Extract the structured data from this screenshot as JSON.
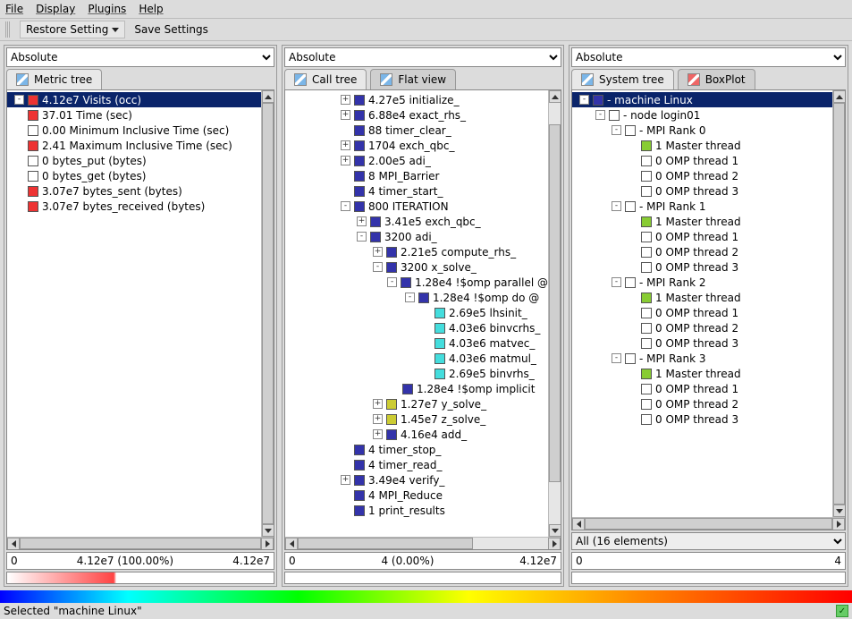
{
  "menubar": [
    "File",
    "Display",
    "Plugins",
    "Help"
  ],
  "toolbar": {
    "restore": "Restore Setting",
    "save": "Save Settings"
  },
  "columns": {
    "c1": {
      "select": "Absolute",
      "tabs": [
        {
          "label": "Metric tree",
          "active": true
        }
      ],
      "tree": [
        {
          "d": 0,
          "e": "-",
          "col": "#e33",
          "sel": true,
          "t": "4.12e7 Visits (occ)"
        },
        {
          "d": 0,
          "e": "",
          "col": "#e33",
          "t": "37.01 Time (sec)"
        },
        {
          "d": 0,
          "e": "",
          "col": "#fff",
          "t": "0.00 Minimum Inclusive Time (sec)"
        },
        {
          "d": 0,
          "e": "",
          "col": "#e33",
          "t": "2.41 Maximum Inclusive Time (sec)"
        },
        {
          "d": 0,
          "e": "",
          "col": "#fff",
          "t": "0 bytes_put (bytes)"
        },
        {
          "d": 0,
          "e": "",
          "col": "#fff",
          "t": "0 bytes_get (bytes)"
        },
        {
          "d": 0,
          "e": "",
          "col": "#e33",
          "t": "3.07e7 bytes_sent (bytes)"
        },
        {
          "d": 0,
          "e": "",
          "col": "#e33",
          "t": "3.07e7 bytes_received (bytes)"
        }
      ],
      "range": {
        "l": "0",
        "m": "4.12e7 (100.00%)",
        "r": "4.12e7"
      },
      "grad": "r"
    },
    "c2": {
      "select": "Absolute",
      "tabs": [
        {
          "label": "Call tree",
          "active": true
        },
        {
          "label": "Flat view",
          "active": false
        }
      ],
      "tree": [
        {
          "d": 3,
          "e": "+",
          "col": "#33a",
          "t": "4.27e5 initialize_"
        },
        {
          "d": 3,
          "e": "+",
          "col": "#33a",
          "t": "6.88e4 exact_rhs_"
        },
        {
          "d": 3,
          "e": "",
          "col": "#33a",
          "t": "88 timer_clear_"
        },
        {
          "d": 3,
          "e": "+",
          "col": "#33a",
          "t": "1704 exch_qbc_"
        },
        {
          "d": 3,
          "e": "+",
          "col": "#33a",
          "t": "2.00e5 adi_"
        },
        {
          "d": 3,
          "e": "",
          "col": "#33a",
          "t": "8 MPI_Barrier"
        },
        {
          "d": 3,
          "e": "",
          "col": "#33a",
          "t": "4 timer_start_"
        },
        {
          "d": 3,
          "e": "-",
          "col": "#33a",
          "t": "800 ITERATION"
        },
        {
          "d": 4,
          "e": "+",
          "col": "#33a",
          "t": "3.41e5 exch_qbc_"
        },
        {
          "d": 4,
          "e": "-",
          "col": "#33a",
          "t": "3200 adi_"
        },
        {
          "d": 5,
          "e": "+",
          "col": "#33a",
          "t": "2.21e5 compute_rhs_"
        },
        {
          "d": 5,
          "e": "-",
          "col": "#33a",
          "t": "3200 x_solve_"
        },
        {
          "d": 6,
          "e": "-",
          "col": "#33a",
          "t": "1.28e4 !$omp parallel @"
        },
        {
          "d": 7,
          "e": "-",
          "col": "#33a",
          "t": "1.28e4 !$omp do @"
        },
        {
          "d": 8,
          "e": "",
          "col": "#4dd",
          "t": "2.69e5 lhsinit_"
        },
        {
          "d": 8,
          "e": "",
          "col": "#4dd",
          "t": "4.03e6 binvcrhs_"
        },
        {
          "d": 8,
          "e": "",
          "col": "#4dd",
          "t": "4.03e6 matvec_"
        },
        {
          "d": 8,
          "e": "",
          "col": "#4dd",
          "t": "4.03e6 matmul_"
        },
        {
          "d": 8,
          "e": "",
          "col": "#4dd",
          "t": "2.69e5 binvrhs_"
        },
        {
          "d": 6,
          "e": "",
          "col": "#33a",
          "t": "1.28e4 !$omp implicit"
        },
        {
          "d": 5,
          "e": "+",
          "col": "#cc3",
          "t": "1.27e7 y_solve_"
        },
        {
          "d": 5,
          "e": "+",
          "col": "#cc3",
          "t": "1.45e7 z_solve_"
        },
        {
          "d": 5,
          "e": "+",
          "col": "#33a",
          "t": "4.16e4 add_"
        },
        {
          "d": 3,
          "e": "",
          "col": "#33a",
          "t": "4 timer_stop_"
        },
        {
          "d": 3,
          "e": "",
          "col": "#33a",
          "t": "4 timer_read_"
        },
        {
          "d": 3,
          "e": "+",
          "col": "#33a",
          "t": "3.49e4 verify_"
        },
        {
          "d": 3,
          "e": "",
          "col": "#33a",
          "t": "4 MPI_Reduce"
        },
        {
          "d": 3,
          "e": "",
          "col": "#33a",
          "t": "1 print_results"
        }
      ],
      "range": {
        "l": "0",
        "m": "4 (0.00%)",
        "r": "4.12e7"
      },
      "grad": "w"
    },
    "c3": {
      "select": "Absolute",
      "tabs": [
        {
          "label": "System tree",
          "active": true
        },
        {
          "label": "BoxPlot",
          "active": false,
          "red": true
        }
      ],
      "tree": [
        {
          "d": 0,
          "e": "-",
          "col": "#33a",
          "sel": true,
          "t": "- machine Linux"
        },
        {
          "d": 1,
          "e": "-",
          "col": "#fff",
          "t": "- node login01"
        },
        {
          "d": 2,
          "e": "-",
          "col": "#fff",
          "t": "- MPI Rank 0"
        },
        {
          "d": 3,
          "e": "",
          "col": "#8c3",
          "t": "1 Master thread"
        },
        {
          "d": 3,
          "e": "",
          "col": "#fff",
          "t": "0 OMP thread 1"
        },
        {
          "d": 3,
          "e": "",
          "col": "#fff",
          "t": "0 OMP thread 2"
        },
        {
          "d": 3,
          "e": "",
          "col": "#fff",
          "t": "0 OMP thread 3"
        },
        {
          "d": 2,
          "e": "-",
          "col": "#fff",
          "t": "- MPI Rank 1"
        },
        {
          "d": 3,
          "e": "",
          "col": "#8c3",
          "t": "1 Master thread"
        },
        {
          "d": 3,
          "e": "",
          "col": "#fff",
          "t": "0 OMP thread 1"
        },
        {
          "d": 3,
          "e": "",
          "col": "#fff",
          "t": "0 OMP thread 2"
        },
        {
          "d": 3,
          "e": "",
          "col": "#fff",
          "t": "0 OMP thread 3"
        },
        {
          "d": 2,
          "e": "-",
          "col": "#fff",
          "t": "- MPI Rank 2"
        },
        {
          "d": 3,
          "e": "",
          "col": "#8c3",
          "t": "1 Master thread"
        },
        {
          "d": 3,
          "e": "",
          "col": "#fff",
          "t": "0 OMP thread 1"
        },
        {
          "d": 3,
          "e": "",
          "col": "#fff",
          "t": "0 OMP thread 2"
        },
        {
          "d": 3,
          "e": "",
          "col": "#fff",
          "t": "0 OMP thread 3"
        },
        {
          "d": 2,
          "e": "-",
          "col": "#fff",
          "t": "- MPI Rank 3"
        },
        {
          "d": 3,
          "e": "",
          "col": "#8c3",
          "t": "1 Master thread"
        },
        {
          "d": 3,
          "e": "",
          "col": "#fff",
          "t": "0 OMP thread 1"
        },
        {
          "d": 3,
          "e": "",
          "col": "#fff",
          "t": "0 OMP thread 2"
        },
        {
          "d": 3,
          "e": "",
          "col": "#fff",
          "t": "0 OMP thread 3"
        }
      ],
      "combo": "All (16 elements)",
      "range": {
        "l": "0",
        "m": "",
        "r": "4"
      },
      "grad": "w"
    }
  },
  "status": "Selected \"machine Linux\""
}
